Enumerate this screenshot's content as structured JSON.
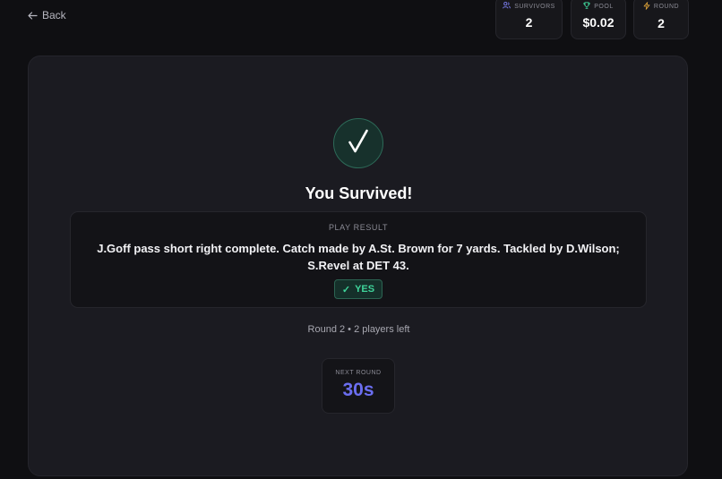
{
  "nav": {
    "back_label": "Back"
  },
  "stats": {
    "survivors": {
      "label": "SURVIVORS",
      "value": "2",
      "icon": "users-icon",
      "color": "#7c7ff2"
    },
    "pool": {
      "label": "POOL",
      "value": "$0.02",
      "icon": "trophy-icon",
      "color": "#3fd49a"
    },
    "round": {
      "label": "ROUND",
      "value": "2",
      "icon": "lightning-icon",
      "color": "#e3a73a"
    }
  },
  "result": {
    "title": "You Survived!",
    "icon": "checkmark-icon",
    "play_label": "PLAY RESULT",
    "play_description": "J.Goff pass short right complete. Catch made by A.St. Brown for 7 yards. Tackled by D.Wilson; S.Revel at DET 43.",
    "answer_check": "✓",
    "answer": "YES"
  },
  "round_info": "Round 2 • 2 players left",
  "next_round": {
    "label": "NEXT ROUND",
    "value": "30s"
  },
  "colors": {
    "accent": "#6b6ef0",
    "success": "#3fd49a",
    "background": "#0f0f12",
    "panel": "#1b1b21"
  }
}
